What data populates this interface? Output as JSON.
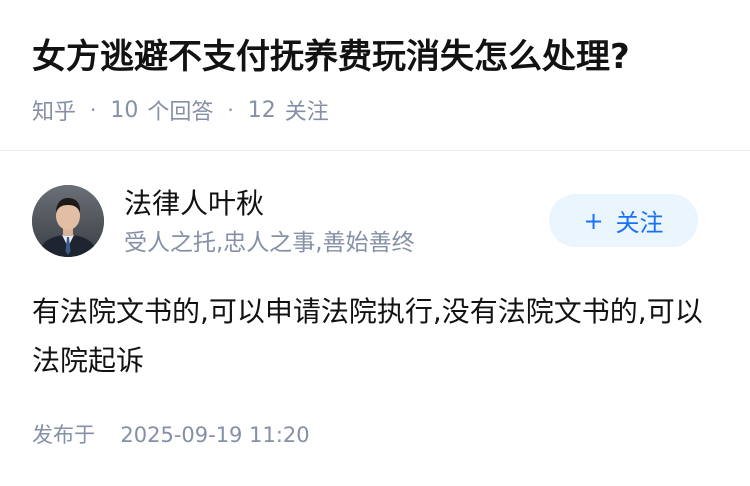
{
  "question": {
    "title": "女方逃避不支付抚养费玩消失怎么处理?",
    "source": "知乎",
    "answer_count": "10",
    "answer_label": "个回答",
    "follower_count": "12",
    "follower_label": "关注"
  },
  "answer": {
    "author": {
      "name": "法律人叶秋",
      "bio": "受人之托,忠人之事,善始善终",
      "avatar_icon": "person-avatar"
    },
    "follow_button": {
      "icon": "plus-icon",
      "label": "关注"
    },
    "content": "有法院文书的,可以申请法院执行,没有法院文书的,可以法院起诉",
    "publish_label": "发布于",
    "publish_time": "2025-09-19 11:20"
  },
  "colors": {
    "primary_text": "#121212",
    "secondary_text": "#8590a6",
    "accent": "#1772f6",
    "follow_bg": "#ebf5fd",
    "divider": "#ebebeb"
  }
}
